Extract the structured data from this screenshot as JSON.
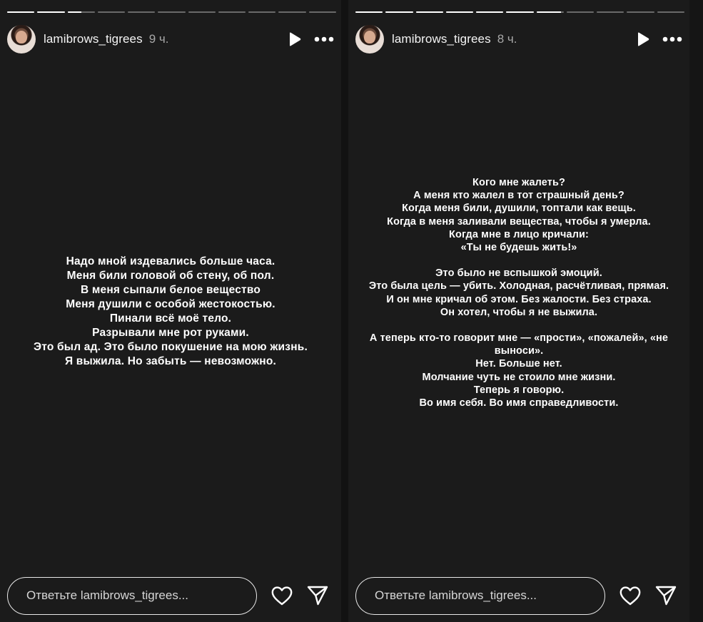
{
  "stories": [
    {
      "username": "lamibrows_tigrees",
      "time": "9 ч.",
      "progress": {
        "segments": 11,
        "completed": 2,
        "current_fraction": 0.5
      },
      "text_lines": [
        "Надо мной издевались больше часа.",
        "Меня били головой об стену, об пол.",
        "В меня сыпали белое вещество",
        "Меня душили с особой жестокостью.",
        "Пинали всё моё тело.",
        "Разрывали мне рот руками.",
        "Это был ад. Это было покушение на мою жизнь.",
        "Я выжила. Но забыть — невозможно."
      ],
      "reply_placeholder": "Ответьте lamibrows_tigrees..."
    },
    {
      "username": "lamibrows_tigrees",
      "time": "8 ч.",
      "progress": {
        "segments": 11,
        "completed": 6,
        "current_fraction": 0.9
      },
      "text_lines": [
        "Кого мне жалеть?",
        "А меня кто жалел в тот страшный день?",
        "Когда меня били, душили, топтали как вещь.",
        "Когда в меня заливали вещества, чтобы я умерла.",
        "Когда мне в лицо кричали:",
        "«Ты не будешь жить!»",
        "",
        "Это было не вспышкой эмоций.",
        "Это была цель — убить. Холодная, расчётливая, прямая.",
        "И он мне кричал об этом. Без жалости. Без страха.",
        "Он хотел, чтобы я не выжила.",
        "",
        "А теперь кто-то говорит мне — «прости», «пожалей», «не",
        "выноси».",
        "Нет. Больше нет.",
        "Молчание чуть не стоило мне жизни.",
        "Теперь я говорю.",
        "Во имя себя. Во имя справедливости."
      ],
      "reply_placeholder": "Ответьте lamibrows_tigrees..."
    }
  ],
  "icons": {
    "play": "play-icon",
    "more": "more-options-icon",
    "like": "heart-icon",
    "share": "send-icon"
  },
  "colors": {
    "background": "#1b1b1b",
    "text": "#ffffff",
    "muted": "#a8a8a8",
    "progress_track": "rgba(255,255,255,0.35)"
  }
}
